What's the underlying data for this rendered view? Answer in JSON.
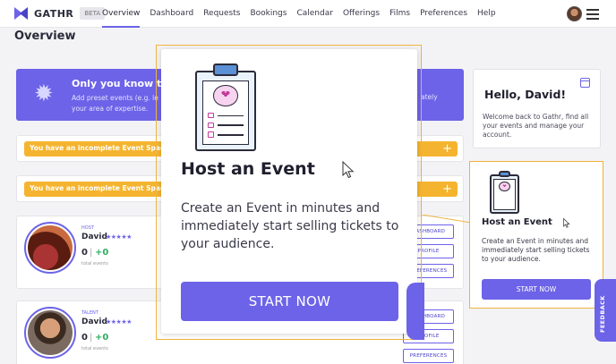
{
  "app": {
    "name": "GATHR",
    "beta_label": "BETA"
  },
  "nav": {
    "items": [
      "Overview",
      "Dashboard",
      "Requests",
      "Bookings",
      "Calendar",
      "Offerings",
      "Films",
      "Preferences",
      "Help"
    ],
    "active": "Overview"
  },
  "page": {
    "title": "Overview"
  },
  "promo": {
    "title": "Only you know th",
    "text": "Add preset events (e.g. le your area of expertise.",
    "text_right": "ately"
  },
  "alerts": [
    {
      "text": "You have an incomplete Event Spac",
      "action": "+"
    },
    {
      "text": "You have an incomplete Event Spac",
      "action": "+"
    }
  ],
  "profiles": [
    {
      "role": "HOST",
      "name": "David",
      "stars": "★★★★★",
      "count": "0",
      "separator": "|",
      "plus": "+0",
      "sub": "total events",
      "buttons": [
        "DASHBOARD",
        "PROFILE",
        "PREFERENCES"
      ]
    },
    {
      "role": "TALENT",
      "name": "David",
      "stars": "★★★★★",
      "count": "0",
      "separator": "|",
      "plus": "+0",
      "sub": "total events",
      "buttons": [
        "DASHBOARD",
        "PROFILE",
        "PREFERENCES"
      ]
    }
  ],
  "welcome": {
    "title": "Hello, David!",
    "text": "Welcome back to Gathr, find all your events and manage your account.",
    "icon": "calendar-icon"
  },
  "host_card": {
    "title": "Host an Event",
    "text": "Create an Event in minutes and immediately start selling tickets to your audience.",
    "button": "START NOW",
    "icon": "clipboard-icon"
  },
  "popup": {
    "title": "Host an Event",
    "text": "Create an Event in minutes and immediately start selling tickets to your audience.",
    "button": "START NOW",
    "icon": "clipboard-icon"
  },
  "feedback": {
    "label": "FEEDBACK"
  },
  "colors": {
    "accent": "#6c63e8",
    "highlight": "#f0b33c",
    "warning": "#f5b42f",
    "positive": "#2fae62"
  }
}
